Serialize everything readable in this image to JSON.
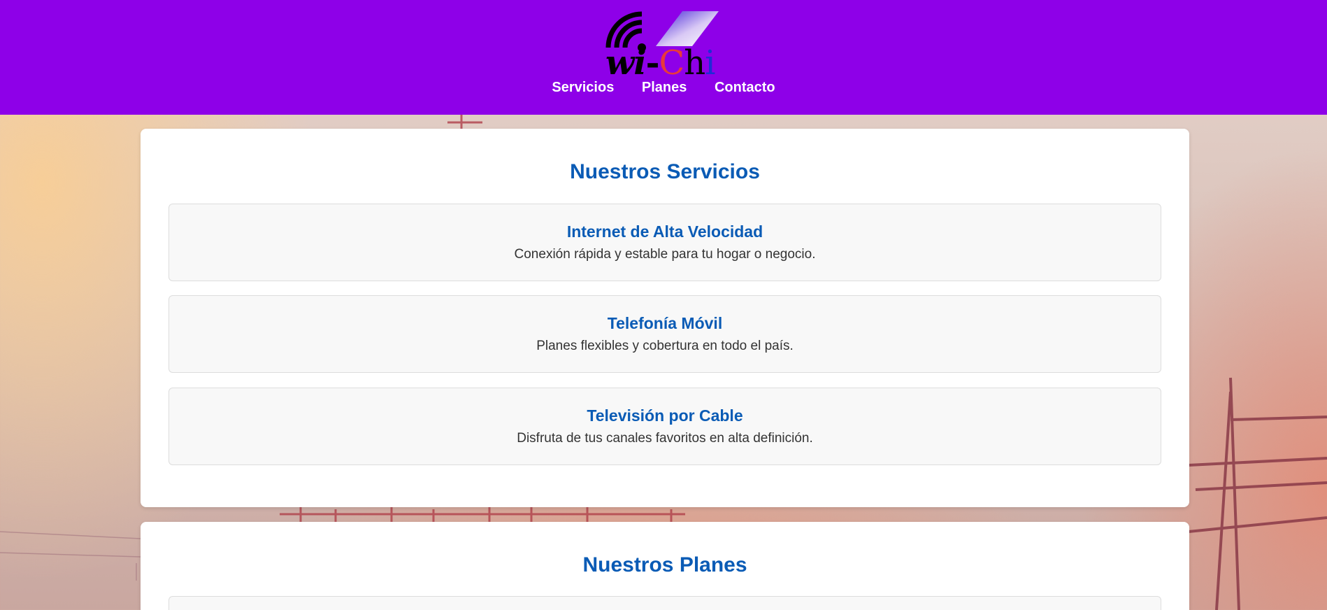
{
  "brand": {
    "logo_text": "wi-Chi",
    "colors": {
      "header_bg": "#8e00e8",
      "heading_blue": "#0a5bb5"
    }
  },
  "nav": {
    "items": [
      {
        "label": "Servicios"
      },
      {
        "label": "Planes"
      },
      {
        "label": "Contacto"
      }
    ]
  },
  "services": {
    "title": "Nuestros Servicios",
    "items": [
      {
        "title": "Internet de Alta Velocidad",
        "description": "Conexión rápida y estable para tu hogar o negocio."
      },
      {
        "title": "Telefonía Móvil",
        "description": "Planes flexibles y cobertura en todo el país."
      },
      {
        "title": "Televisión por Cable",
        "description": "Disfruta de tus canales favoritos en alta definición."
      }
    ]
  },
  "plans": {
    "title": "Nuestros Planes"
  }
}
